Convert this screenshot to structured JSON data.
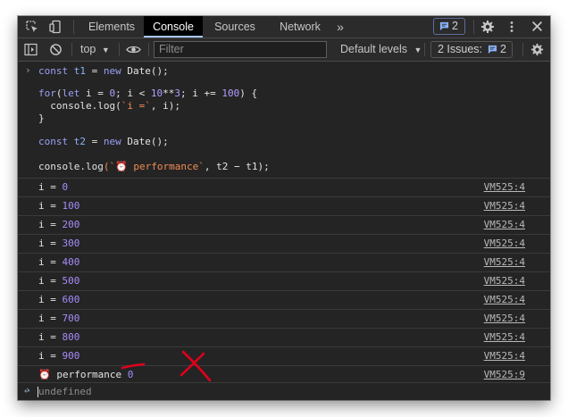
{
  "tabs": {
    "items": [
      "Elements",
      "Console",
      "Sources",
      "Network"
    ],
    "active": "Console",
    "more": "»",
    "issues_count": "2"
  },
  "toolbar": {
    "context": "top",
    "filter_placeholder": "Filter",
    "levels": "Default levels",
    "issues_label": "2 Issues:",
    "issues_count": "2"
  },
  "code": {
    "line1": {
      "kw": "const",
      "id": "t1",
      "rest": " = ",
      "kw2": "new",
      "call": " Date();"
    },
    "line2": {
      "kw": "for",
      "a": "(",
      "kw2": "let",
      "b": " i = ",
      "n1": "0",
      "c": "; i < ",
      "n2": "10",
      "d": "**",
      "n3": "3",
      "e": "; i += ",
      "n4": "100",
      "f": ") {"
    },
    "line3": {
      "a": "  console.",
      "b": "log",
      "c": "(",
      "s": "`i =`",
      "d": ", i);"
    },
    "line4": "}",
    "line5": {
      "kw": "const",
      "id": "t2",
      "rest": " = ",
      "kw2": "new",
      "call": " Date();"
    },
    "line6": {
      "a": "console.",
      "b": "log",
      "c": "(`",
      "emoji": "⏰",
      "s": " performance`",
      "d": ", t2 − t1);"
    }
  },
  "output": {
    "rows": [
      {
        "label": "i = ",
        "value": "0",
        "source": "VM525:4"
      },
      {
        "label": "i = ",
        "value": "100",
        "source": "VM525:4"
      },
      {
        "label": "i = ",
        "value": "200",
        "source": "VM525:4"
      },
      {
        "label": "i = ",
        "value": "300",
        "source": "VM525:4"
      },
      {
        "label": "i = ",
        "value": "400",
        "source": "VM525:4"
      },
      {
        "label": "i = ",
        "value": "500",
        "source": "VM525:4"
      },
      {
        "label": "i = ",
        "value": "600",
        "source": "VM525:4"
      },
      {
        "label": "i = ",
        "value": "700",
        "source": "VM525:4"
      },
      {
        "label": "i = ",
        "value": "800",
        "source": "VM525:4"
      },
      {
        "label": "i = ",
        "value": "900",
        "source": "VM525:4"
      }
    ],
    "perf": {
      "emoji": "⏰",
      "label": " performance ",
      "value": "0",
      "source": "VM525:9"
    },
    "result": "undefined"
  },
  "colors": {
    "accent": "#a8c7fa",
    "annotation": "#e0001b"
  }
}
